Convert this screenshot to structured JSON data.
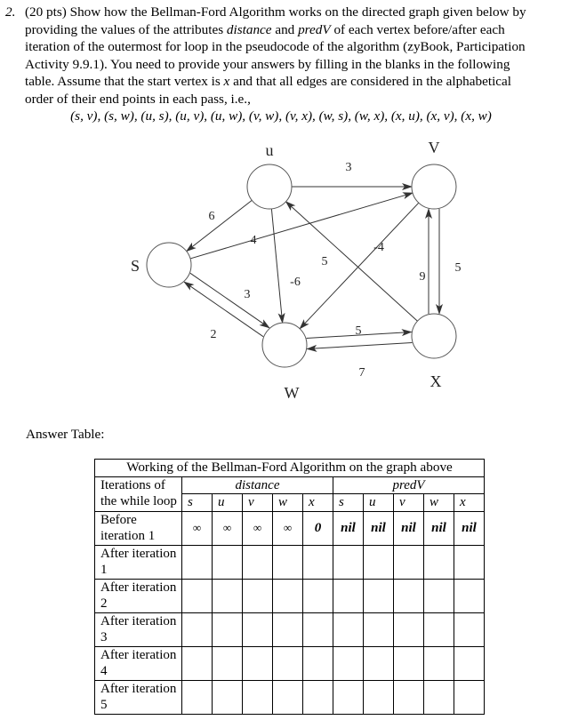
{
  "question": {
    "number": "2.",
    "points": "(20 pts)",
    "lines": [
      [
        "(20 pts) Show how the Bellman-Ford Algorithm works on the directed graph given below by"
      ],
      [
        "providing the values of the attributes ",
        "distance",
        " and ",
        "predV",
        " of each vertex before/after each"
      ],
      [
        "iteration of the outermost for loop in the pseudocode of the algorithm (zyBook, Participation"
      ],
      [
        "Activity 9.9.1). You need to provide your answers by filling in the blanks in the following"
      ],
      [
        "table. Assume that the start vertex is ",
        "x",
        " and that all edges are considered in the alphabetical"
      ],
      [
        "order of their end points in each pass, i.e.,"
      ]
    ],
    "edge_order": "(s, v), (s, w), (u, s), (u, v), (u, w), (v, w), (v, x), (w, s), (w, x), (x, u), (x, v), (x, w)"
  },
  "graph": {
    "vertices": [
      {
        "id": "s",
        "label": "S"
      },
      {
        "id": "u",
        "label": "u"
      },
      {
        "id": "v",
        "label": "V"
      },
      {
        "id": "w",
        "label": "W"
      },
      {
        "id": "x",
        "label": "X"
      }
    ],
    "edges": [
      {
        "from": "u",
        "to": "s",
        "weight": "6"
      },
      {
        "from": "s",
        "to": "v",
        "weight": "4"
      },
      {
        "from": "u",
        "to": "v",
        "weight": "3"
      },
      {
        "from": "x",
        "to": "u",
        "weight": "5"
      },
      {
        "from": "v",
        "to": "w",
        "weight": "-4"
      },
      {
        "from": "u",
        "to": "w",
        "weight": "-6"
      },
      {
        "from": "x",
        "to": "v",
        "weight": "9"
      },
      {
        "from": "v",
        "to": "x",
        "weight": "5"
      },
      {
        "from": "s",
        "to": "w",
        "weight": "2"
      },
      {
        "from": "w",
        "to": "s",
        "weight": "3"
      },
      {
        "from": "w",
        "to": "x",
        "weight": "5"
      },
      {
        "from": "x",
        "to": "w",
        "weight": "7"
      }
    ]
  },
  "answer": {
    "label": "Answer Table:",
    "title": "Working of the Bellman-Ford Algorithm on the graph above",
    "row_header": "Iterations of the while loop",
    "groups": [
      "distance",
      "predV"
    ],
    "columns": [
      "s",
      "u",
      "v",
      "w",
      "x"
    ],
    "rows": [
      {
        "label": "Before iteration 1",
        "distance": [
          "∞",
          "∞",
          "∞",
          "∞",
          "0"
        ],
        "predV": [
          "nil",
          "nil",
          "nil",
          "nil",
          "nil"
        ]
      },
      {
        "label": "After iteration 1",
        "distance": [
          "",
          "",
          "",
          "",
          ""
        ],
        "predV": [
          "",
          "",
          "",
          "",
          ""
        ]
      },
      {
        "label": "After iteration 2",
        "distance": [
          "",
          "",
          "",
          "",
          ""
        ],
        "predV": [
          "",
          "",
          "",
          "",
          ""
        ]
      },
      {
        "label": "After iteration 3",
        "distance": [
          "",
          "",
          "",
          "",
          ""
        ],
        "predV": [
          "",
          "",
          "",
          "",
          ""
        ]
      },
      {
        "label": "After iteration 4",
        "distance": [
          "",
          "",
          "",
          "",
          ""
        ],
        "predV": [
          "",
          "",
          "",
          "",
          ""
        ]
      },
      {
        "label": "After iteration 5",
        "distance": [
          "",
          "",
          "",
          "",
          ""
        ],
        "predV": [
          "",
          "",
          "",
          "",
          ""
        ]
      }
    ]
  }
}
